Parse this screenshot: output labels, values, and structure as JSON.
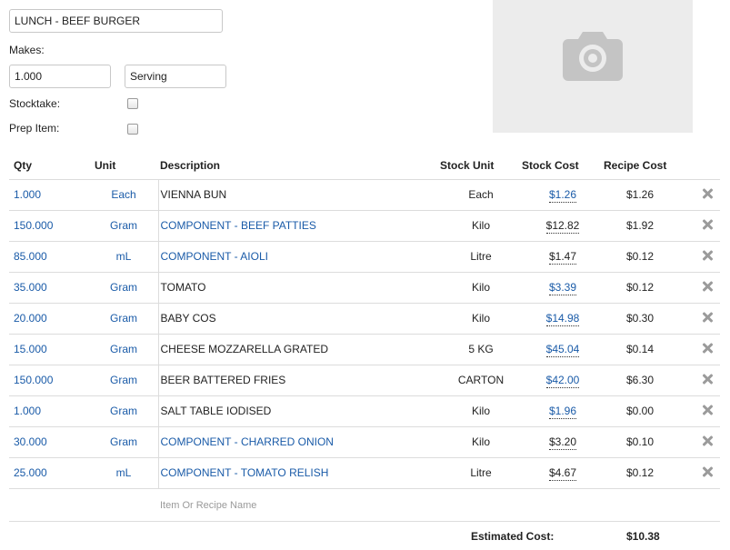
{
  "recipe": {
    "name": "LUNCH - BEEF BURGER",
    "makes_label": "Makes:",
    "makes_qty": "1.000",
    "makes_unit": "Serving",
    "stocktake_label": "Stocktake:",
    "stocktake_checked": false,
    "prep_item_label": "Prep Item:",
    "prep_item_checked": false,
    "photo_icon": "camera-icon"
  },
  "table": {
    "headers": {
      "qty": "Qty",
      "unit": "Unit",
      "description": "Description",
      "stock_unit": "Stock Unit",
      "stock_cost": "Stock Cost",
      "recipe_cost": "Recipe Cost"
    },
    "rows": [
      {
        "qty": "1.000",
        "unit": "Each",
        "description": "VIENNA BUN",
        "desc_link": false,
        "stock_unit": "Each",
        "stock_cost": "$1.26",
        "cost_link": true,
        "recipe_cost": "$1.26"
      },
      {
        "qty": "150.000",
        "unit": "Gram",
        "description": "COMPONENT - BEEF PATTIES",
        "desc_link": true,
        "stock_unit": "Kilo",
        "stock_cost": "$12.82",
        "cost_link": false,
        "recipe_cost": "$1.92"
      },
      {
        "qty": "85.000",
        "unit": "mL",
        "description": "COMPONENT - AIOLI",
        "desc_link": true,
        "stock_unit": "Litre",
        "stock_cost": "$1.47",
        "cost_link": false,
        "recipe_cost": "$0.12"
      },
      {
        "qty": "35.000",
        "unit": "Gram",
        "description": "TOMATO",
        "desc_link": false,
        "stock_unit": "Kilo",
        "stock_cost": "$3.39",
        "cost_link": true,
        "recipe_cost": "$0.12"
      },
      {
        "qty": "20.000",
        "unit": "Gram",
        "description": "BABY COS",
        "desc_link": false,
        "stock_unit": "Kilo",
        "stock_cost": "$14.98",
        "cost_link": true,
        "recipe_cost": "$0.30"
      },
      {
        "qty": "15.000",
        "unit": "Gram",
        "description": "CHEESE MOZZARELLA GRATED",
        "desc_link": false,
        "stock_unit": "5 KG",
        "stock_cost": "$45.04",
        "cost_link": true,
        "recipe_cost": "$0.14"
      },
      {
        "qty": "150.000",
        "unit": "Gram",
        "description": "BEER BATTERED FRIES",
        "desc_link": false,
        "stock_unit": "CARTON",
        "stock_cost": "$42.00",
        "cost_link": true,
        "recipe_cost": "$6.30"
      },
      {
        "qty": "1.000",
        "unit": "Gram",
        "description": "SALT TABLE IODISED",
        "desc_link": false,
        "stock_unit": "Kilo",
        "stock_cost": "$1.96",
        "cost_link": true,
        "recipe_cost": "$0.00"
      },
      {
        "qty": "30.000",
        "unit": "Gram",
        "description": "COMPONENT - CHARRED ONION",
        "desc_link": true,
        "stock_unit": "Kilo",
        "stock_cost": "$3.20",
        "cost_link": false,
        "recipe_cost": "$0.10"
      },
      {
        "qty": "25.000",
        "unit": "mL",
        "description": "COMPONENT - TOMATO RELISH",
        "desc_link": true,
        "stock_unit": "Litre",
        "stock_cost": "$4.67",
        "cost_link": false,
        "recipe_cost": "$0.12"
      }
    ],
    "delete_icon": "close-icon",
    "new_item_placeholder": "Item Or Recipe Name"
  },
  "footer": {
    "estimated_cost_label": "Estimated Cost:",
    "estimated_cost_value": "$10.38"
  },
  "colors": {
    "link": "#1a5ba8",
    "photo_bg": "#ececec",
    "border": "#dcdcdc"
  }
}
